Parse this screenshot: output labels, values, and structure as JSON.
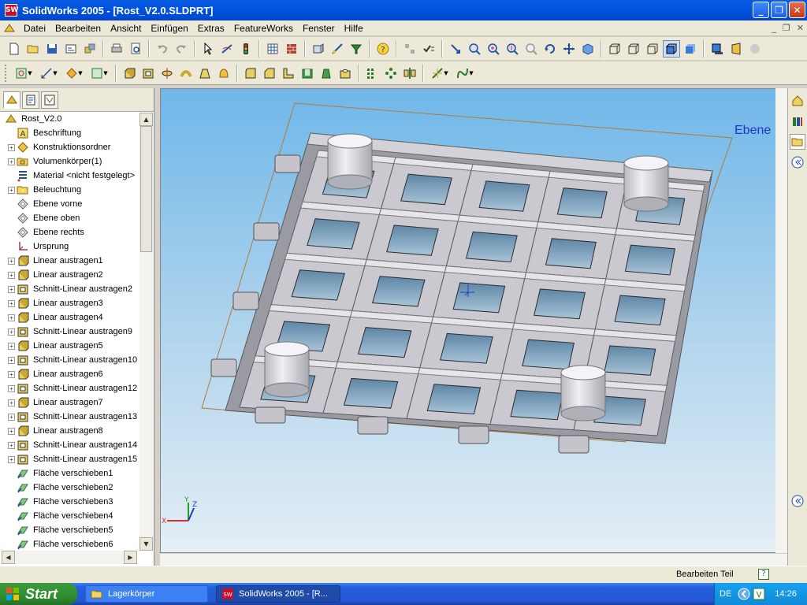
{
  "window": {
    "title": "SolidWorks 2005 - [Rost_V2.0.SLDPRT]"
  },
  "menu": [
    "Datei",
    "Bearbeiten",
    "Ansicht",
    "Einfügen",
    "Extras",
    "FeatureWorks",
    "Fenster",
    "Hilfe"
  ],
  "tree": {
    "root": "Rost_V2.0",
    "items": [
      {
        "label": "Beschriftung",
        "icon": "annotation-icon",
        "expandable": false
      },
      {
        "label": "Konstruktionsordner",
        "icon": "design-folder-icon",
        "expandable": true
      },
      {
        "label": "Volumenkörper(1)",
        "icon": "solid-bodies-folder-icon",
        "expandable": true
      },
      {
        "label": "Material <nicht festgelegt>",
        "icon": "material-icon",
        "expandable": false
      },
      {
        "label": "Beleuchtung",
        "icon": "lighting-folder-icon",
        "expandable": true
      },
      {
        "label": "Ebene vorne",
        "icon": "plane-icon",
        "expandable": false
      },
      {
        "label": "Ebene oben",
        "icon": "plane-icon",
        "expandable": false
      },
      {
        "label": "Ebene rechts",
        "icon": "plane-icon",
        "expandable": false
      },
      {
        "label": "Ursprung",
        "icon": "origin-icon",
        "expandable": false
      },
      {
        "label": "Linear austragen1",
        "icon": "extrude-icon",
        "expandable": true
      },
      {
        "label": "Linear austragen2",
        "icon": "extrude-icon",
        "expandable": true
      },
      {
        "label": "Schnitt-Linear austragen2",
        "icon": "cut-extrude-icon",
        "expandable": true
      },
      {
        "label": "Linear austragen3",
        "icon": "extrude-icon",
        "expandable": true
      },
      {
        "label": "Linear austragen4",
        "icon": "extrude-icon",
        "expandable": true
      },
      {
        "label": "Schnitt-Linear austragen9",
        "icon": "cut-extrude-icon",
        "expandable": true
      },
      {
        "label": "Linear austragen5",
        "icon": "extrude-icon",
        "expandable": true
      },
      {
        "label": "Schnitt-Linear austragen10",
        "icon": "cut-extrude-icon",
        "expandable": true
      },
      {
        "label": "Linear austragen6",
        "icon": "extrude-icon",
        "expandable": true
      },
      {
        "label": "Schnitt-Linear austragen12",
        "icon": "cut-extrude-icon",
        "expandable": true
      },
      {
        "label": "Linear austragen7",
        "icon": "extrude-icon",
        "expandable": true
      },
      {
        "label": "Schnitt-Linear austragen13",
        "icon": "cut-extrude-icon",
        "expandable": true
      },
      {
        "label": "Linear austragen8",
        "icon": "extrude-icon",
        "expandable": true
      },
      {
        "label": "Schnitt-Linear austragen14",
        "icon": "cut-extrude-icon",
        "expandable": true
      },
      {
        "label": "Schnitt-Linear austragen15",
        "icon": "cut-extrude-icon",
        "expandable": true
      },
      {
        "label": "Fläche verschieben1",
        "icon": "move-face-icon",
        "expandable": false
      },
      {
        "label": "Fläche verschieben2",
        "icon": "move-face-icon",
        "expandable": false
      },
      {
        "label": "Fläche verschieben3",
        "icon": "move-face-icon",
        "expandable": false
      },
      {
        "label": "Fläche verschieben4",
        "icon": "move-face-icon",
        "expandable": false
      },
      {
        "label": "Fläche verschieben5",
        "icon": "move-face-icon",
        "expandable": false
      },
      {
        "label": "Fläche verschieben6",
        "icon": "move-face-icon",
        "expandable": false
      }
    ]
  },
  "viewport": {
    "plane_label": "Ebene",
    "triad": {
      "x": "X",
      "y": "Y",
      "z": "Z"
    }
  },
  "status": {
    "text": "Bearbeiten Teil",
    "help": "?"
  },
  "taskbar": {
    "start": "Start",
    "tasks": [
      "Lagerkörper",
      "SolidWorks 2005 - [R..."
    ],
    "language": "DE",
    "clock": "14:26"
  },
  "colors": {
    "titlebar": "#0054e3",
    "viewport_top": "#6fb7e9",
    "part": "#c8c8cc"
  }
}
